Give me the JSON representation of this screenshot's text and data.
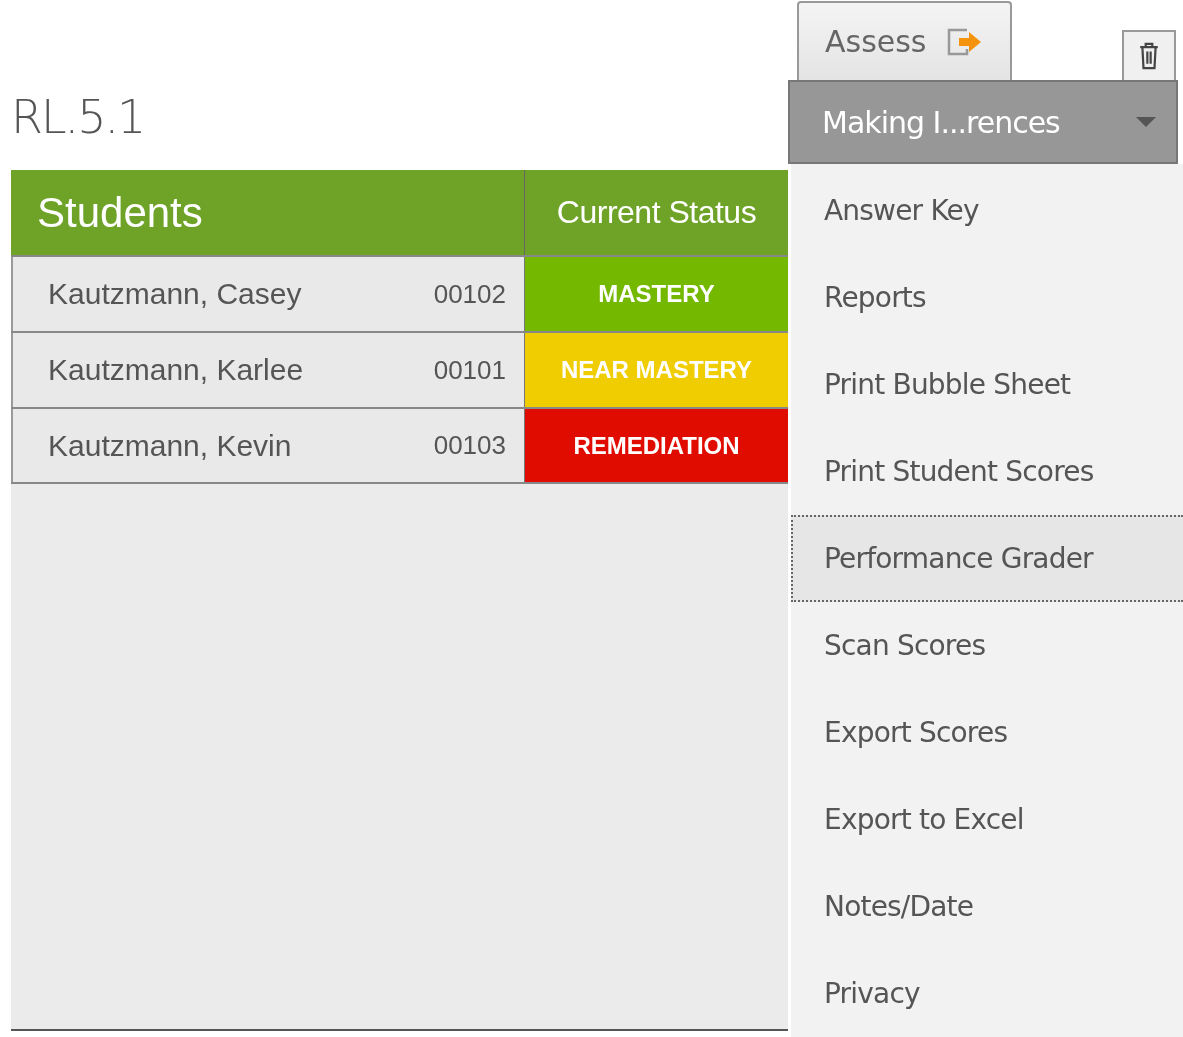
{
  "standard": {
    "title": "RL.5.1"
  },
  "table": {
    "columns": [
      "Students",
      "Current Status"
    ],
    "rows": [
      {
        "name": "Kautzmann, Casey",
        "id": "00102",
        "status": "MASTERY",
        "color": "#74b800"
      },
      {
        "name": "Kautzmann, Karlee",
        "id": "00101",
        "status": "NEAR MASTERY",
        "color": "#f0cd00"
      },
      {
        "name": "Kautzmann, Kevin",
        "id": "00103",
        "status": "REMEDIATION",
        "color": "#e00c00"
      }
    ]
  },
  "tab": {
    "label": "Assess"
  },
  "dropdown": {
    "value": "Making I...rences",
    "expanded": true
  },
  "menu": [
    {
      "label": "Answer Key",
      "selected": false
    },
    {
      "label": "Reports",
      "selected": false
    },
    {
      "label": "Print Bubble Sheet",
      "selected": false
    },
    {
      "label": "Print Student Scores",
      "selected": false
    },
    {
      "label": "Performance Grader",
      "selected": true
    },
    {
      "label": "Scan Scores",
      "selected": false
    },
    {
      "label": "Export Scores",
      "selected": false
    },
    {
      "label": "Export to Excel",
      "selected": false
    },
    {
      "label": "Notes/Date",
      "selected": false
    },
    {
      "label": "Privacy",
      "selected": false
    }
  ]
}
